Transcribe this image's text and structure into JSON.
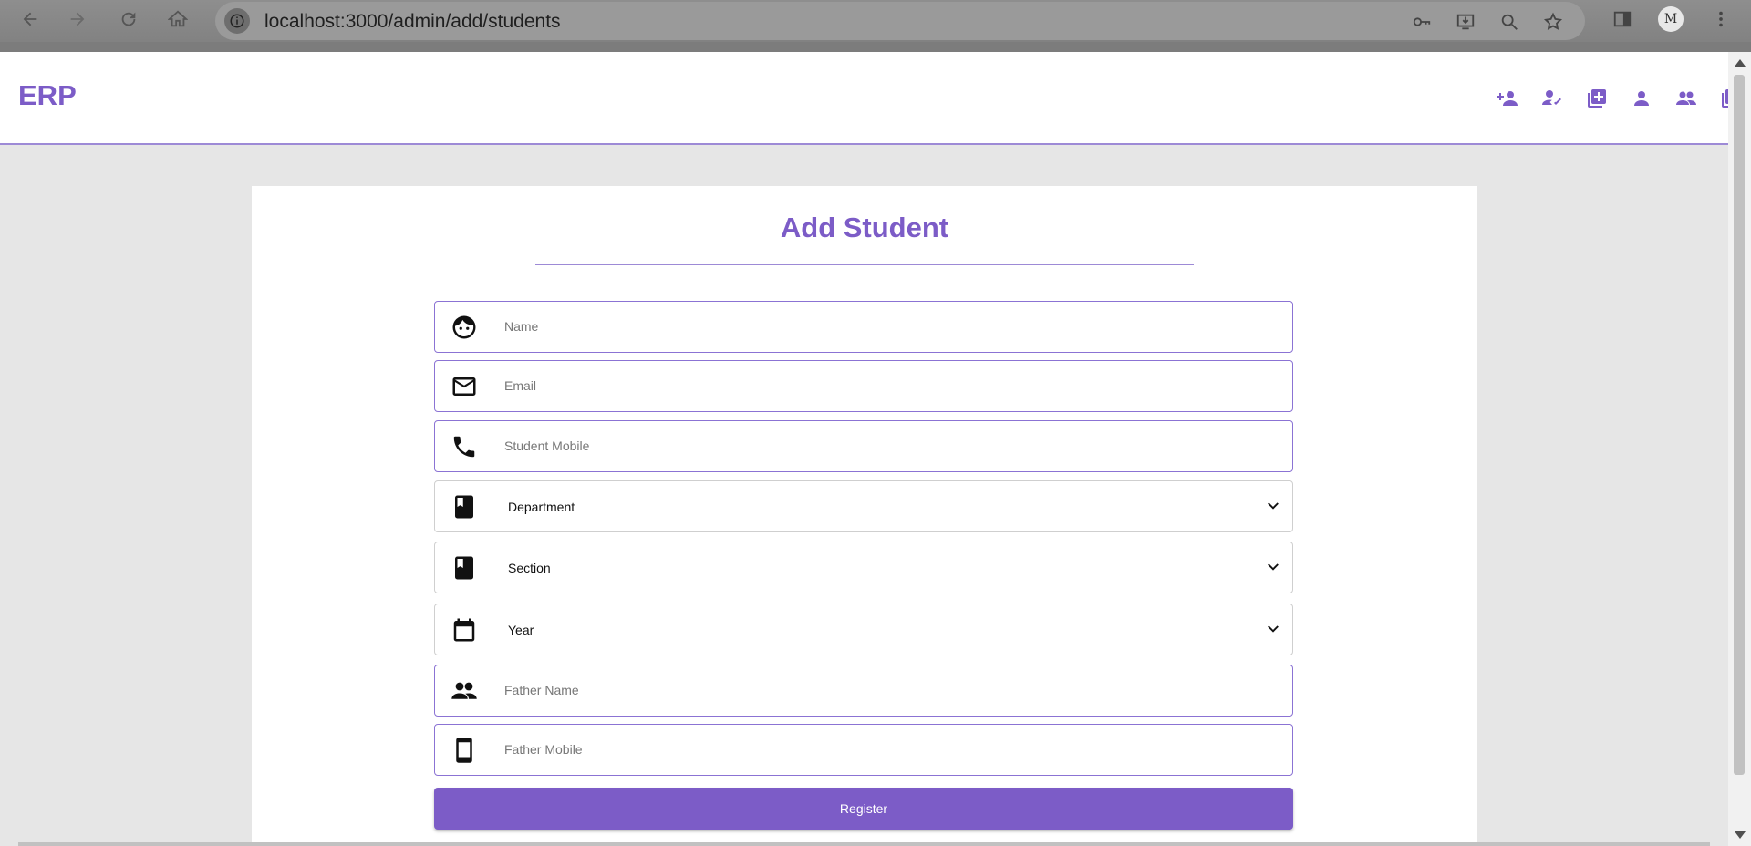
{
  "browser": {
    "url": "localhost:3000/admin/add/students",
    "profile_initials": "M"
  },
  "navbar": {
    "brand": "ERP",
    "icons": [
      "person-add-icon",
      "how-to-reg-icon",
      "library-add-icon",
      "person-icon",
      "group-icon",
      "library-books-icon",
      "logout-icon"
    ]
  },
  "form": {
    "title": "Add Student",
    "fields": {
      "name": {
        "placeholder": "Name",
        "value": "",
        "icon": "face-icon"
      },
      "email": {
        "placeholder": "Email",
        "value": "",
        "icon": "mail-icon"
      },
      "student_mobile": {
        "placeholder": "Student Mobile",
        "value": "",
        "icon": "phone-icon"
      },
      "department": {
        "selected": "Department",
        "icon": "book-icon"
      },
      "section": {
        "selected": "Section",
        "icon": "book-icon"
      },
      "year": {
        "selected": "Year",
        "icon": "calendar-icon"
      },
      "father_name": {
        "placeholder": "Father Name",
        "value": "",
        "icon": "group-icon"
      },
      "father_mobile": {
        "placeholder": "Father Mobile",
        "value": "",
        "icon": "smartphone-icon"
      }
    },
    "register_label": "Register"
  },
  "colors": {
    "accent": "#7c5cc7",
    "page_bg": "#e6e6e6",
    "card_bg": "#ffffff"
  }
}
